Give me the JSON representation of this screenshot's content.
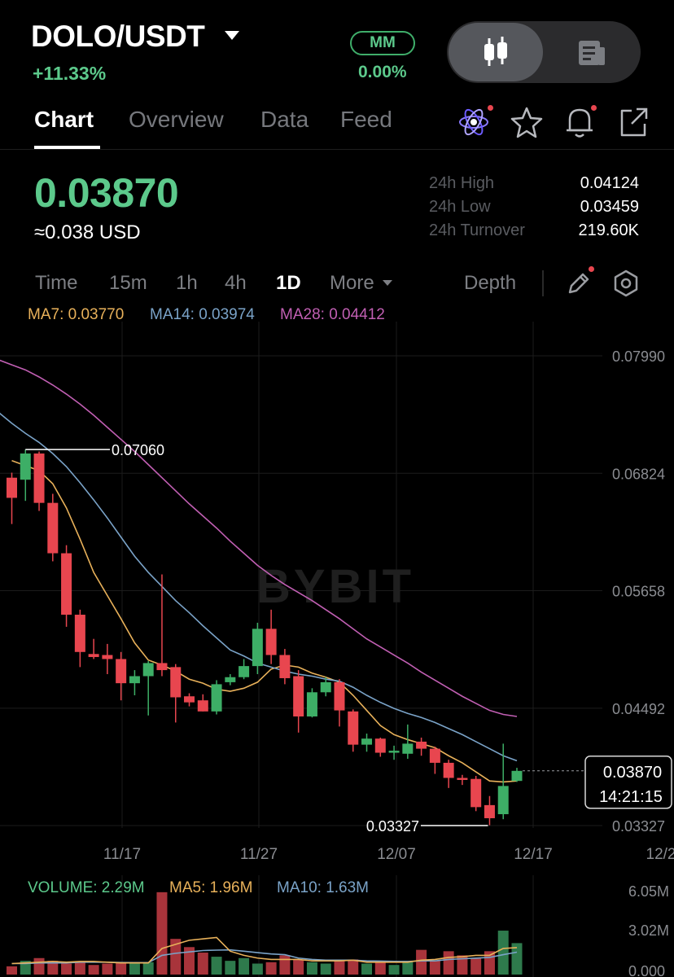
{
  "header": {
    "pair": "DOLO/USDT",
    "change": "+11.33%",
    "mm_label": "MM",
    "mm_value": "0.00%",
    "view_toggle": [
      "candlestick-icon",
      "news-icon"
    ]
  },
  "tabs": [
    "Chart",
    "Overview",
    "Data",
    "Feed"
  ],
  "active_tab": "Chart",
  "header_icons": [
    "atom-icon",
    "star-icon",
    "bell-icon",
    "share-icon"
  ],
  "price": {
    "last": "0.03870",
    "usd": "≈0.038 USD"
  },
  "stats": [
    {
      "label": "24h High",
      "value": "0.04124"
    },
    {
      "label": "24h Low",
      "value": "0.03459"
    },
    {
      "label": "24h Turnover",
      "value": "219.60K"
    }
  ],
  "timeframes": [
    "Time",
    "15m",
    "1h",
    "4h",
    "1D",
    "More"
  ],
  "active_timeframe": "1D",
  "depth_label": "Depth",
  "ma_legend": [
    {
      "label": "MA7: 0.03770",
      "color": "#e8b15a"
    },
    {
      "label": "MA14: 0.03974",
      "color": "#7aa3c8"
    },
    {
      "label": "MA28: 0.04412",
      "color": "#c15fb3"
    }
  ],
  "colors": {
    "up": "#3dae66",
    "down": "#e8464f",
    "accent_green": "#5cc98b"
  },
  "watermark": "BYBIT",
  "chart_data": {
    "type": "candlestick",
    "interval": "1D",
    "ylim": [
      0.0333,
      0.08
    ],
    "yticks": [
      "0.07990",
      "0.06824",
      "0.05658",
      "0.04492",
      "0.03327"
    ],
    "xticks": [
      "11/17",
      "11/27",
      "12/07",
      "12/17",
      "12/2"
    ],
    "annotations": {
      "high": "0.07060",
      "low": "0.03327"
    },
    "current_price": "0.03870",
    "countdown": "14:21:15",
    "candles": [
      {
        "o": 0.0678,
        "h": 0.0683,
        "l": 0.0632,
        "c": 0.0658
      },
      {
        "o": 0.0676,
        "h": 0.0706,
        "l": 0.0655,
        "c": 0.0702
      },
      {
        "o": 0.0702,
        "h": 0.0704,
        "l": 0.0645,
        "c": 0.0653
      },
      {
        "o": 0.0653,
        "h": 0.0662,
        "l": 0.0595,
        "c": 0.0603
      },
      {
        "o": 0.0603,
        "h": 0.0611,
        "l": 0.053,
        "c": 0.0542
      },
      {
        "o": 0.0542,
        "h": 0.0547,
        "l": 0.049,
        "c": 0.0505
      },
      {
        "o": 0.0503,
        "h": 0.0518,
        "l": 0.0498,
        "c": 0.05
      },
      {
        "o": 0.0502,
        "h": 0.0513,
        "l": 0.0483,
        "c": 0.0498
      },
      {
        "o": 0.0498,
        "h": 0.0505,
        "l": 0.0457,
        "c": 0.0474
      },
      {
        "o": 0.0474,
        "h": 0.0487,
        "l": 0.0462,
        "c": 0.0481
      },
      {
        "o": 0.0481,
        "h": 0.0496,
        "l": 0.0442,
        "c": 0.0494
      },
      {
        "o": 0.0494,
        "h": 0.0582,
        "l": 0.0481,
        "c": 0.0487
      },
      {
        "o": 0.049,
        "h": 0.0493,
        "l": 0.0435,
        "c": 0.046
      },
      {
        "o": 0.0461,
        "h": 0.0464,
        "l": 0.0451,
        "c": 0.0455
      },
      {
        "o": 0.0457,
        "h": 0.0463,
        "l": 0.0446,
        "c": 0.0446
      },
      {
        "o": 0.0446,
        "h": 0.0477,
        "l": 0.0443,
        "c": 0.0473
      },
      {
        "o": 0.0475,
        "h": 0.0483,
        "l": 0.0472,
        "c": 0.048
      },
      {
        "o": 0.048,
        "h": 0.0498,
        "l": 0.0478,
        "c": 0.0491
      },
      {
        "o": 0.0491,
        "h": 0.0534,
        "l": 0.0483,
        "c": 0.0528
      },
      {
        "o": 0.0528,
        "h": 0.0547,
        "l": 0.0493,
        "c": 0.0502
      },
      {
        "o": 0.0502,
        "h": 0.0508,
        "l": 0.0473,
        "c": 0.0479
      },
      {
        "o": 0.0481,
        "h": 0.0487,
        "l": 0.0425,
        "c": 0.0441
      },
      {
        "o": 0.0441,
        "h": 0.0469,
        "l": 0.044,
        "c": 0.0465
      },
      {
        "o": 0.0465,
        "h": 0.048,
        "l": 0.0461,
        "c": 0.0475
      },
      {
        "o": 0.0475,
        "h": 0.0478,
        "l": 0.0431,
        "c": 0.0447
      },
      {
        "o": 0.0446,
        "h": 0.0448,
        "l": 0.0406,
        "c": 0.0413
      },
      {
        "o": 0.0413,
        "h": 0.0424,
        "l": 0.0406,
        "c": 0.0419
      },
      {
        "o": 0.0419,
        "h": 0.042,
        "l": 0.0401,
        "c": 0.0405
      },
      {
        "o": 0.0405,
        "h": 0.0412,
        "l": 0.0398,
        "c": 0.0407
      },
      {
        "o": 0.0404,
        "h": 0.0433,
        "l": 0.0399,
        "c": 0.0414
      },
      {
        "o": 0.0416,
        "h": 0.042,
        "l": 0.0402,
        "c": 0.0409
      },
      {
        "o": 0.0409,
        "h": 0.0411,
        "l": 0.0384,
        "c": 0.0395
      },
      {
        "o": 0.0395,
        "h": 0.0398,
        "l": 0.037,
        "c": 0.038
      },
      {
        "o": 0.038,
        "h": 0.0383,
        "l": 0.0373,
        "c": 0.0378
      },
      {
        "o": 0.0379,
        "h": 0.0382,
        "l": 0.0347,
        "c": 0.0351
      },
      {
        "o": 0.0353,
        "h": 0.0362,
        "l": 0.0333,
        "c": 0.034
      },
      {
        "o": 0.0344,
        "h": 0.0414,
        "l": 0.0339,
        "c": 0.0372
      },
      {
        "o": 0.0377,
        "h": 0.039,
        "l": 0.0376,
        "c": 0.0387
      }
    ],
    "ma_series": [
      {
        "name": "MA7",
        "values": [
          0.0695,
          0.069,
          0.0685,
          0.0672,
          0.0648,
          0.0617,
          0.0584,
          0.0561,
          0.0538,
          0.0514,
          0.0497,
          0.0492,
          0.0486,
          0.0478,
          0.0474,
          0.0468,
          0.0466,
          0.0469,
          0.0475,
          0.0488,
          0.0492,
          0.049,
          0.0484,
          0.048,
          0.0475,
          0.0462,
          0.0447,
          0.0432,
          0.0423,
          0.0418,
          0.0414,
          0.041,
          0.0402,
          0.0395,
          0.0386,
          0.0377,
          0.0376,
          0.0377
        ]
      },
      {
        "name": "MA14",
        "values": [
          0.0732,
          0.0722,
          0.0713,
          0.0702,
          0.0689,
          0.0673,
          0.0656,
          0.0638,
          0.0619,
          0.06,
          0.0584,
          0.057,
          0.0556,
          0.0544,
          0.0531,
          0.0519,
          0.0507,
          0.0501,
          0.0494,
          0.049,
          0.0486,
          0.0483,
          0.0481,
          0.0478,
          0.0476,
          0.047,
          0.0462,
          0.0455,
          0.0449,
          0.0444,
          0.044,
          0.0435,
          0.0429,
          0.0423,
          0.0416,
          0.0409,
          0.0402,
          0.0397
        ]
      },
      {
        "name": "MA28",
        "values": [
          0.079,
          0.0785,
          0.0778,
          0.077,
          0.0761,
          0.0751,
          0.074,
          0.0728,
          0.0716,
          0.0704,
          0.0691,
          0.0678,
          0.0665,
          0.0652,
          0.064,
          0.0628,
          0.0615,
          0.0603,
          0.0591,
          0.0581,
          0.0572,
          0.0564,
          0.0556,
          0.0547,
          0.0538,
          0.0528,
          0.0518,
          0.051,
          0.0502,
          0.0494,
          0.0485,
          0.0477,
          0.0469,
          0.0461,
          0.0454,
          0.0447,
          0.0443,
          0.0441
        ]
      }
    ],
    "volume": {
      "legend": [
        {
          "label": "VOLUME: 2.29M",
          "color": "#5cc98b"
        },
        {
          "label": "MA5: 1.96M",
          "color": "#e8b15a"
        },
        {
          "label": "MA10: 1.63M",
          "color": "#7aa3c8"
        }
      ],
      "yticks": [
        "6.05M",
        "3.02M",
        "0.000"
      ],
      "ylim": [
        0,
        6.05
      ],
      "values_m": [
        0.6,
        1.0,
        1.2,
        1.0,
        0.8,
        0.9,
        0.7,
        0.8,
        0.9,
        0.8,
        0.9,
        6.0,
        2.6,
        2.0,
        1.6,
        1.3,
        1.0,
        1.2,
        0.8,
        0.9,
        1.4,
        1.1,
        0.9,
        0.8,
        1.0,
        1.1,
        0.8,
        0.9,
        0.7,
        1.0,
        1.8,
        1.0,
        1.7,
        1.4,
        1.2,
        1.7,
        3.2,
        2.29
      ],
      "ma5_m": [
        0.8,
        0.85,
        0.9,
        0.95,
        0.9,
        0.95,
        0.95,
        0.9,
        0.85,
        0.85,
        0.85,
        1.9,
        2.2,
        2.5,
        2.6,
        2.7,
        1.7,
        1.4,
        1.2,
        1.1,
        1.1,
        1.1,
        1.0,
        1.0,
        1.0,
        1.05,
        0.9,
        0.9,
        0.9,
        0.9,
        1.05,
        1.1,
        1.25,
        1.3,
        1.4,
        1.4,
        1.9,
        1.96
      ],
      "ma10_m": [
        0.8,
        0.8,
        0.85,
        0.85,
        0.85,
        0.9,
        0.9,
        0.9,
        0.88,
        0.87,
        0.87,
        1.4,
        1.55,
        1.65,
        1.75,
        1.78,
        1.8,
        1.7,
        1.6,
        1.5,
        1.45,
        1.2,
        1.1,
        1.05,
        1.05,
        1.05,
        1.0,
        0.98,
        0.96,
        0.95,
        1.0,
        1.0,
        1.1,
        1.15,
        1.2,
        1.25,
        1.45,
        1.63
      ]
    }
  }
}
